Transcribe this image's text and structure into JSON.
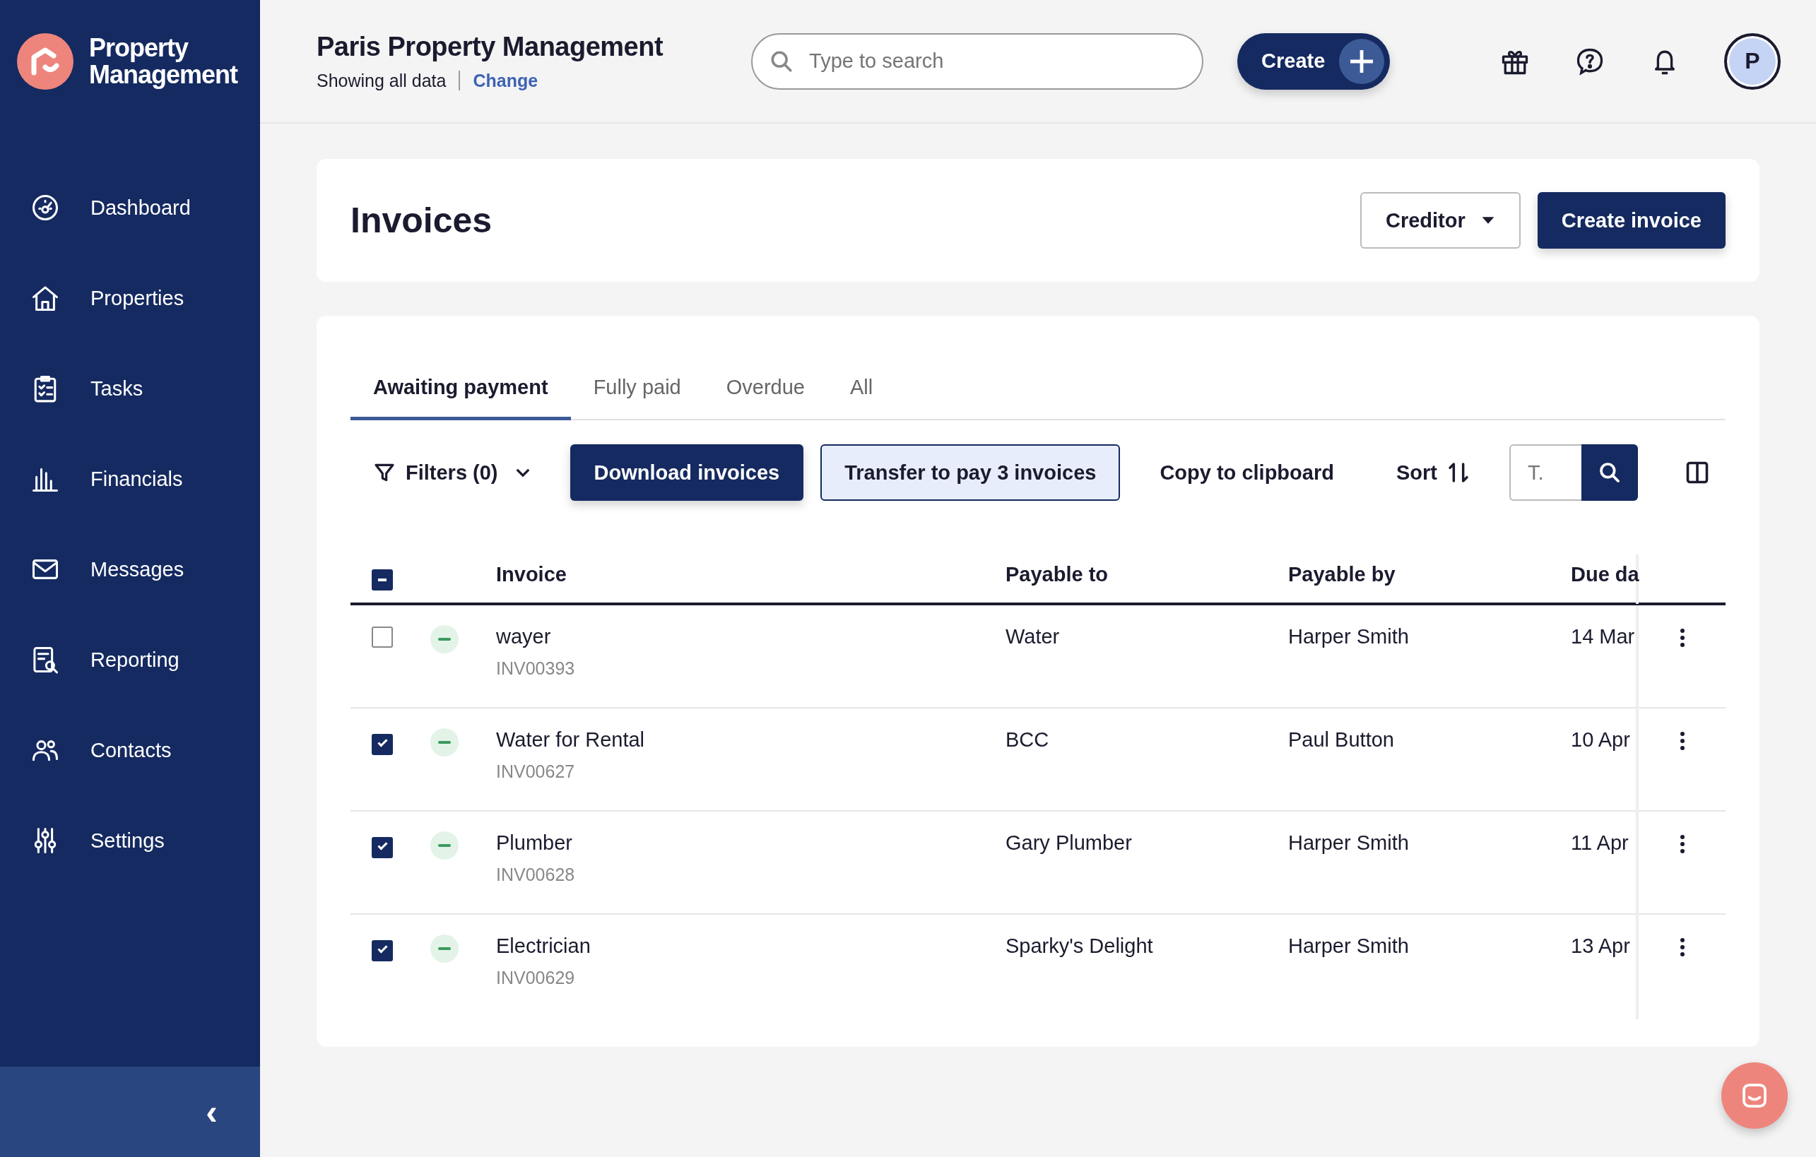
{
  "brand": {
    "name": "Property Management"
  },
  "sidebar": {
    "items": [
      {
        "label": "Dashboard",
        "selected": false
      },
      {
        "label": "Properties",
        "selected": false
      },
      {
        "label": "Tasks",
        "selected": false
      },
      {
        "label": "Financials",
        "selected": false
      },
      {
        "label": "Messages",
        "selected": false
      },
      {
        "label": "Reporting",
        "selected": false
      },
      {
        "label": "Contacts",
        "selected": false
      },
      {
        "label": "Settings",
        "selected": false
      }
    ],
    "collapse": "‹"
  },
  "header": {
    "title": "Paris Property Management",
    "scope": "Showing all data",
    "change_link": "Change",
    "search": {
      "placeholder": "Type to search"
    },
    "create_button": "Create",
    "avatar": "P"
  },
  "page": {
    "title": "Invoices",
    "creditor_button": "Creditor",
    "create_invoice_button": "Create invoice"
  },
  "tabs": [
    {
      "label": "Awaiting payment",
      "selected": true
    },
    {
      "label": "Fully paid",
      "selected": false
    },
    {
      "label": "Overdue",
      "selected": false
    },
    {
      "label": "All",
      "selected": false
    }
  ],
  "toolbar": {
    "filters": "Filters (0)",
    "download": "Download invoices",
    "transfer": "Transfer to pay 3 invoices",
    "copy": "Copy to clipboard",
    "sort": "Sort",
    "search": {
      "placeholder": "T."
    }
  },
  "table": {
    "select_all_partial": true,
    "columns": [
      "Invoice",
      "Payable to",
      "Payable by",
      "Due da"
    ],
    "rows": [
      {
        "checked": false,
        "name": "wayer",
        "number": "INV00393",
        "payable_to": "Water",
        "payable_by": "Harper Smith",
        "due": "14 Mar"
      },
      {
        "checked": true,
        "name": "Water for Rental",
        "number": "INV00627",
        "payable_to": "BCC",
        "payable_by": "Paul Button",
        "due": "10 Apr"
      },
      {
        "checked": true,
        "name": "Plumber",
        "number": "INV00628",
        "payable_to": "Gary Plumber",
        "payable_by": "Harper Smith",
        "due": "11 Apr"
      },
      {
        "checked": true,
        "name": "Electrician",
        "number": "INV00629",
        "payable_to": "Sparky's Delight",
        "payable_by": "Harper Smith",
        "due": "13 Apr"
      }
    ]
  }
}
